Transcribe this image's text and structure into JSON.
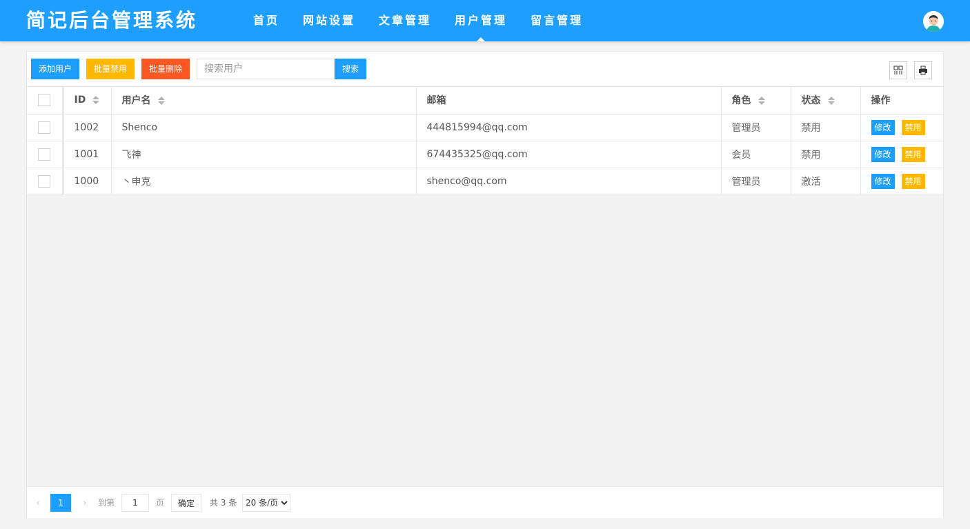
{
  "header": {
    "logo": "简记后台管理系统",
    "nav": [
      "首页",
      "网站设置",
      "文章管理",
      "用户管理",
      "留言管理"
    ],
    "active_nav": "用户管理"
  },
  "toolbar": {
    "add_label": "添加用户",
    "batch_disable_label": "批量禁用",
    "batch_delete_label": "批量删除",
    "search_placeholder": "搜索用户",
    "search_label": "搜索",
    "icons": [
      "columns-filter-icon",
      "print-icon"
    ]
  },
  "table": {
    "headers": {
      "id": "ID",
      "username": "用户名",
      "email": "邮箱",
      "role": "角色",
      "status": "状态",
      "actions": "操作"
    },
    "rows": [
      {
        "id": "1002",
        "username": "Shenco",
        "email": "444815994@qq.com",
        "role": "管理员",
        "status": "禁用",
        "edit": "修改",
        "toggle": "禁用"
      },
      {
        "id": "1001",
        "username": "飞神",
        "email": "674435325@qq.com",
        "role": "会员",
        "status": "禁用",
        "edit": "修改",
        "toggle": "禁用"
      },
      {
        "id": "1000",
        "username": "丶申克",
        "email": "shenco@qq.com",
        "role": "管理员",
        "status": "激活",
        "edit": "修改",
        "toggle": "禁用"
      }
    ]
  },
  "pager": {
    "current_page": "1",
    "goto_prefix": "到第",
    "goto_value": "1",
    "goto_suffix": "页",
    "confirm_label": "确定",
    "total_text": "共 3 条",
    "page_size": "20 条/页"
  },
  "colors": {
    "primary": "#1e9fff",
    "warn": "#ffb800",
    "danger": "#ff5722"
  }
}
